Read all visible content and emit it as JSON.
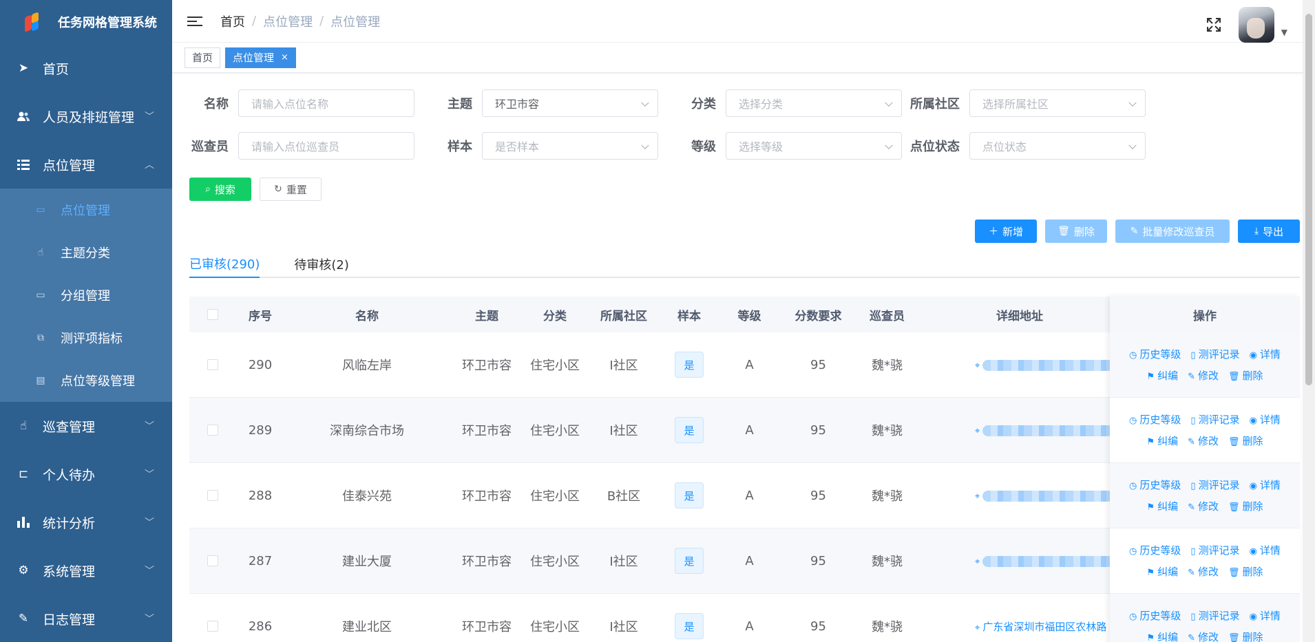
{
  "app": {
    "title": "任务网格管理系统",
    "logo_colors": [
      "#f5a623",
      "#e94b3c",
      "#1890ff"
    ]
  },
  "sidebar": {
    "items": [
      {
        "label": "首页",
        "icon": "paper-plane-icon"
      },
      {
        "label": "人员及排班管理",
        "icon": "users-icon",
        "expandable": true
      },
      {
        "label": "点位管理",
        "icon": "list-icon",
        "expanded": true,
        "children": [
          {
            "label": "点位管理",
            "icon": "calendar-icon",
            "active": true
          },
          {
            "label": "主题分类",
            "icon": "hand-icon"
          },
          {
            "label": "分组管理",
            "icon": "calendar-icon"
          },
          {
            "label": "测评项指标",
            "icon": "puzzle-icon"
          },
          {
            "label": "点位等级管理",
            "icon": "document-icon"
          }
        ]
      },
      {
        "label": "巡查管理",
        "icon": "hand-icon",
        "expandable": true
      },
      {
        "label": "个人待办",
        "icon": "tree-icon",
        "expandable": true
      },
      {
        "label": "统计分析",
        "icon": "bar-chart-icon",
        "expandable": true
      },
      {
        "label": "系统管理",
        "icon": "gear-icon",
        "expandable": true
      },
      {
        "label": "日志管理",
        "icon": "edit-icon",
        "expandable": true
      }
    ]
  },
  "header": {
    "breadcrumb": [
      "首页",
      "点位管理",
      "点位管理"
    ]
  },
  "tags": [
    {
      "label": "首页"
    },
    {
      "label": "点位管理",
      "active": true,
      "close": "×"
    }
  ],
  "filters": {
    "name": {
      "label": "名称",
      "placeholder": "请输入点位名称"
    },
    "theme": {
      "label": "主题",
      "value": "环卫市容"
    },
    "category": {
      "label": "分类",
      "placeholder": "选择分类"
    },
    "community": {
      "label": "所属社区",
      "placeholder": "选择所属社区"
    },
    "inspector": {
      "label": "巡查员",
      "placeholder": "请输入点位巡查员"
    },
    "sample": {
      "label": "样本",
      "placeholder": "是否样本"
    },
    "level": {
      "label": "等级",
      "placeholder": "选择等级"
    },
    "status": {
      "label": "点位状态",
      "placeholder": "点位状态"
    },
    "search_btn": "搜索",
    "reset_btn": "重置"
  },
  "toolbar": {
    "add": "新增",
    "delete": "删除",
    "batch_edit": "批量修改巡查员",
    "export": "导出"
  },
  "tabs": [
    {
      "label": "已审核(290)",
      "active": true
    },
    {
      "label": "待审核(2)"
    }
  ],
  "table": {
    "columns": [
      "序号",
      "名称",
      "主题",
      "分类",
      "所属社区",
      "样本",
      "等级",
      "分数要求",
      "巡查员",
      "详细地址",
      "操作"
    ],
    "ops_row1": [
      "历史等级",
      "测评记录",
      "详情"
    ],
    "ops_row2": [
      "纠编",
      "修改",
      "删除"
    ],
    "rows": [
      {
        "no": "290",
        "name": "风临左岸",
        "theme": "环卫市容",
        "cat": "住宅小区",
        "comm": "I社区",
        "sample": "是",
        "level": "A",
        "score": "95",
        "insp": "魏*骁",
        "addr": ""
      },
      {
        "no": "289",
        "name": "深南综合市场",
        "theme": "环卫市容",
        "cat": "住宅小区",
        "comm": "I社区",
        "sample": "是",
        "level": "A",
        "score": "95",
        "insp": "魏*骁",
        "addr": ""
      },
      {
        "no": "288",
        "name": "佳泰兴苑",
        "theme": "环卫市容",
        "cat": "住宅小区",
        "comm": "B社区",
        "sample": "是",
        "level": "A",
        "score": "95",
        "insp": "魏*骁",
        "addr": ""
      },
      {
        "no": "287",
        "name": "建业大厦",
        "theme": "环卫市容",
        "cat": "住宅小区",
        "comm": "I社区",
        "sample": "是",
        "level": "A",
        "score": "95",
        "insp": "魏*骁",
        "addr": ""
      },
      {
        "no": "286",
        "name": "建业北区",
        "theme": "环卫市容",
        "cat": "住宅小区",
        "comm": "I社区",
        "sample": "是",
        "level": "A",
        "score": "95",
        "insp": "魏*骁",
        "addr": "广东省深圳市福田区农林路"
      }
    ]
  }
}
